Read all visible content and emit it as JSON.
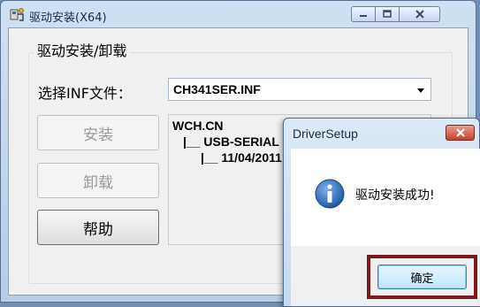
{
  "main_window": {
    "title": "驱动安装(X64)",
    "group_title": "驱动安装/卸载",
    "inf_label": "选择INF文件：",
    "inf_selected": "CH341SER.INF",
    "buttons": {
      "install": "安装",
      "uninstall": "卸载",
      "help": "帮助"
    },
    "info_lines": [
      "WCH.CN",
      "|__ USB-SERIAL",
      "|__ 11/04/2011"
    ]
  },
  "dialog": {
    "title": "DriverSetup",
    "message": "驱动安装成功!",
    "ok_label": "确定"
  },
  "colors": {
    "highlight_border": "#7b1a1c",
    "close_button": "#c7402b",
    "info_icon": "#2f6fb8"
  },
  "icons": {
    "app": "driver-setup-icon",
    "info": "information-icon"
  }
}
